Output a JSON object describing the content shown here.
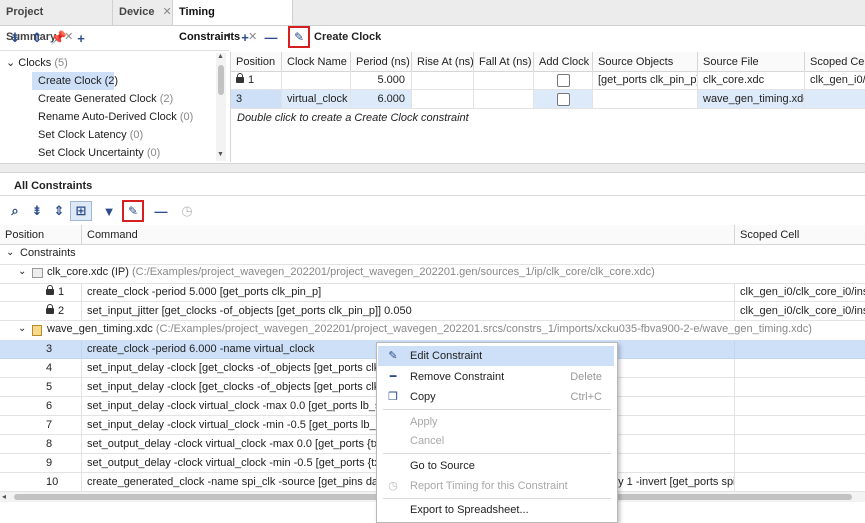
{
  "tabs": [
    {
      "label": "Project Summary"
    },
    {
      "label": "Device"
    },
    {
      "label": "Timing Constraints"
    }
  ],
  "top_toolbar": {
    "create_clock_label": "Create Clock"
  },
  "tree": {
    "root": {
      "label": "Clocks",
      "count": "(5)"
    },
    "items": [
      {
        "label": "Create Clock",
        "count": "(2)"
      },
      {
        "label": "Create Generated Clock",
        "count": "(2)"
      },
      {
        "label": "Rename Auto-Derived Clock",
        "count": "(0)"
      },
      {
        "label": "Set Clock Latency",
        "count": "(0)"
      },
      {
        "label": "Set Clock Uncertainty",
        "count": "(0)"
      }
    ]
  },
  "clock_table": {
    "headers": [
      "Position",
      "Clock Name",
      "Period (ns)",
      "Rise At (ns)",
      "Fall At (ns)",
      "Add Clock",
      "Source Objects",
      "Source File",
      "Scoped Cell"
    ],
    "rows": [
      {
        "position": "1",
        "clock_name": "",
        "period": "5.000",
        "rise": "",
        "fall": "",
        "source_objects": "[get_ports clk_pin_p]",
        "source_file": "clk_core.xdc",
        "scoped_cell": "clk_gen_i0/clk"
      },
      {
        "position": "3",
        "clock_name": "virtual_clock",
        "period": "6.000",
        "rise": "",
        "fall": "",
        "source_objects": "",
        "source_file": "wave_gen_timing.xdc",
        "scoped_cell": ""
      }
    ],
    "hint": "Double click to create a Create Clock constraint"
  },
  "all_constraints": {
    "title": "All Constraints",
    "headers": [
      "Position",
      "Command",
      "Scoped Cell"
    ],
    "root_label": "Constraints",
    "file1": {
      "name": "clk_core.xdc (IP)",
      "path": "(C:/Examples/project_wavegen_202201/project_wavegen_202201.gen/sources_1/ip/clk_core/clk_core.xdc)"
    },
    "file1_rows": [
      {
        "position": "1",
        "command": "create_clock -period 5.000 [get_ports clk_pin_p]",
        "scoped": "clk_gen_i0/clk_core_i0/inst"
      },
      {
        "position": "2",
        "command": "set_input_jitter [get_clocks -of_objects [get_ports clk_pin_p]] 0.050",
        "scoped": "clk_gen_i0/clk_core_i0/inst"
      }
    ],
    "file2": {
      "name": "wave_gen_timing.xdc",
      "path": "(C:/Examples/project_wavegen_202201/project_wavegen_202201.srcs/constrs_1/imports/xcku035-fbva900-2-e/wave_gen_timing.xdc)"
    },
    "file2_rows": [
      {
        "position": "3",
        "command": "create_clock -period 6.000 -name virtual_clock",
        "scoped": ""
      },
      {
        "position": "4",
        "command": "set_input_delay -clock [get_clocks -of_objects [get_ports clk_pin_p]]",
        "scoped": ""
      },
      {
        "position": "5",
        "command": "set_input_delay -clock [get_clocks -of_objects [get_ports clk_pin_p]]",
        "scoped": ""
      },
      {
        "position": "6",
        "command": "set_input_delay -clock virtual_clock -max 0.0 [get_ports lb_sel_pin]",
        "scoped": ""
      },
      {
        "position": "7",
        "command": "set_input_delay -clock virtual_clock -min -0.5 [get_ports lb_sel_pin]",
        "scoped": ""
      },
      {
        "position": "8",
        "command": "set_output_delay -clock virtual_clock -max 0.0 [get_ports {txd_pin (le",
        "scoped": ""
      },
      {
        "position": "9",
        "command": "set_output_delay -clock virtual_clock -min -0.5 [get_ports {txd_pin (l",
        "scoped": ""
      },
      {
        "position": "10",
        "command": "create_generated_clock -name spi_clk -source [get_pins dac_spi_i0/",
        "scoped": ""
      }
    ],
    "row10_tail": "by 1 -invert [get_ports spi_cl"
  },
  "context_menu": {
    "items": [
      {
        "label": "Edit Constraint",
        "shortcut": ""
      },
      {
        "label": "Remove Constraint",
        "shortcut": "Delete"
      },
      {
        "label": "Copy",
        "shortcut": "Ctrl+C"
      },
      {
        "label": "Apply",
        "shortcut": ""
      },
      {
        "label": "Cancel",
        "shortcut": ""
      },
      {
        "label": "Go to Source",
        "shortcut": ""
      },
      {
        "label": "Report Timing for this Constraint",
        "shortcut": ""
      },
      {
        "label": "Export to Spreadsheet...",
        "shortcut": ""
      }
    ]
  },
  "colors": {
    "accent": "#2b4c8a",
    "selection": "#cde0f7",
    "highlight_box": "#d62020"
  }
}
